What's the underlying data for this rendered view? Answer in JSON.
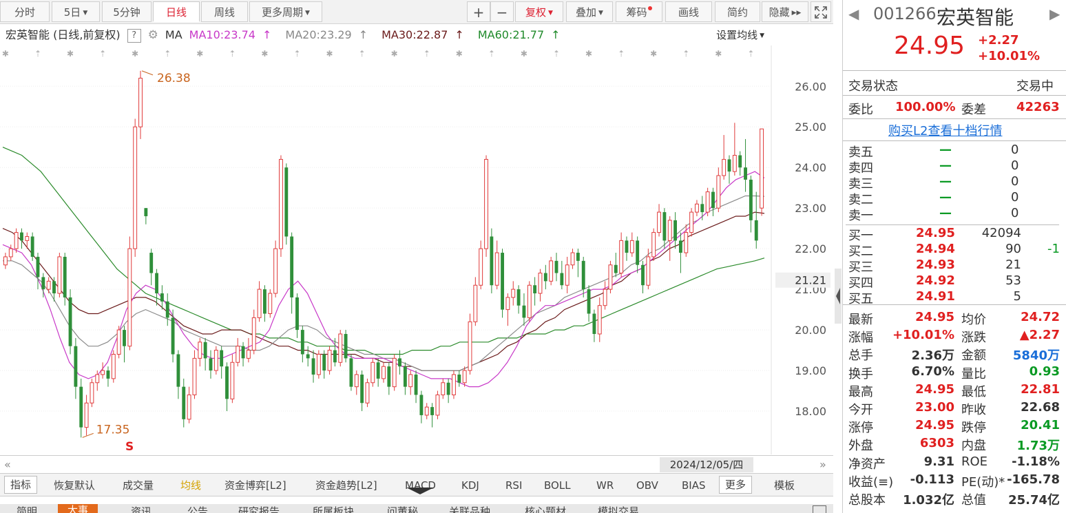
{
  "toolbar": {
    "tabs": [
      "分时",
      "5日",
      "5分钟",
      "日线",
      "周线",
      "更多周期"
    ],
    "buttons": [
      "+",
      "−",
      "复权",
      "叠加",
      "筹码",
      "画线",
      "简约",
      "隐藏"
    ],
    "active_tab": "日线"
  },
  "legend": {
    "title": "宏英智能 (日线,前复权)",
    "help": "?",
    "ma_label": "MA",
    "ma10": "MA10:23.74",
    "ma20": "MA20:23.29",
    "ma30": "MA30:22.87",
    "ma60": "MA60:21.77",
    "arrow": "↑",
    "set_ma": "设置均线"
  },
  "chart_data": {
    "type": "candlestick",
    "ylim": [
      17.0,
      26.7
    ],
    "yticks": [
      "26.00",
      "25.00",
      "24.00",
      "23.00",
      "22.00",
      "21.00",
      "20.00",
      "19.00",
      "18.00"
    ],
    "current_price_tag": "21.21",
    "high_annotation": "26.38",
    "low_annotation": "17.35",
    "s_marker": "S",
    "date_label": "2024/12/05/四",
    "colors": {
      "up": "#e03a3a",
      "down": "#2f8f3a",
      "ma10": "#c838c8",
      "ma20": "#8a8a8a",
      "ma30": "#6a1a1a",
      "ma60": "#2a8a2a"
    },
    "candles": [
      [
        21.6,
        21.8,
        21.9,
        21.5
      ],
      [
        21.8,
        22.0,
        22.1,
        21.7
      ],
      [
        22.0,
        22.4,
        22.5,
        21.9
      ],
      [
        22.4,
        22.2,
        22.5,
        22.0
      ],
      [
        22.2,
        22.3,
        22.4,
        22.0
      ],
      [
        22.3,
        21.8,
        22.4,
        21.7
      ],
      [
        21.8,
        21.3,
        21.9,
        21.0
      ],
      [
        21.3,
        21.0,
        21.4,
        20.8
      ],
      [
        21.0,
        21.2,
        21.3,
        20.9
      ],
      [
        21.2,
        20.9,
        21.3,
        20.7
      ],
      [
        20.9,
        21.8,
        21.9,
        20.8
      ],
      [
        21.8,
        20.8,
        21.9,
        20.6
      ],
      [
        20.8,
        19.6,
        21.0,
        19.4
      ],
      [
        19.6,
        18.6,
        19.8,
        18.3
      ],
      [
        18.6,
        17.6,
        18.8,
        17.35
      ],
      [
        17.6,
        18.2,
        18.4,
        17.4
      ],
      [
        18.2,
        18.7,
        18.8,
        18.1
      ],
      [
        18.7,
        18.9,
        19.0,
        18.5
      ],
      [
        18.9,
        19.0,
        19.2,
        18.8
      ],
      [
        19.0,
        18.8,
        19.1,
        18.6
      ],
      [
        18.8,
        19.4,
        19.5,
        18.7
      ],
      [
        19.4,
        20.0,
        20.1,
        19.3
      ],
      [
        20.0,
        19.6,
        20.1,
        19.2
      ],
      [
        19.6,
        22.0,
        22.3,
        19.5
      ],
      [
        22.0,
        25.0,
        25.2,
        21.8
      ],
      [
        25.0,
        26.2,
        26.38,
        24.7
      ],
      [
        23.0,
        22.8,
        23.0,
        22.6
      ],
      [
        21.9,
        21.4,
        22.0,
        21.1
      ],
      [
        21.4,
        20.9,
        21.5,
        20.6
      ],
      [
        20.9,
        20.7,
        21.1,
        20.5
      ],
      [
        20.7,
        20.3,
        20.9,
        20.1
      ],
      [
        20.3,
        19.4,
        20.5,
        19.2
      ],
      [
        19.4,
        18.6,
        19.5,
        18.3
      ],
      [
        18.6,
        17.8,
        18.8,
        17.6
      ],
      [
        17.8,
        18.4,
        18.6,
        17.7
      ],
      [
        18.4,
        19.3,
        19.5,
        18.3
      ],
      [
        19.3,
        19.7,
        19.8,
        19.1
      ],
      [
        19.7,
        19.3,
        19.8,
        19.0
      ],
      [
        19.3,
        19.0,
        19.5,
        18.8
      ],
      [
        19.0,
        19.5,
        19.6,
        18.9
      ],
      [
        19.5,
        19.1,
        19.6,
        18.8
      ],
      [
        19.1,
        18.3,
        19.2,
        18.0
      ],
      [
        18.3,
        19.2,
        19.4,
        18.2
      ],
      [
        19.2,
        19.6,
        19.8,
        19.1
      ],
      [
        19.6,
        19.3,
        19.7,
        19.1
      ],
      [
        19.3,
        19.5,
        19.8,
        19.2
      ],
      [
        19.5,
        20.3,
        20.5,
        19.4
      ],
      [
        20.3,
        21.0,
        21.2,
        20.2
      ],
      [
        21.0,
        20.4,
        21.1,
        20.2
      ],
      [
        20.4,
        20.9,
        21.0,
        20.3
      ],
      [
        20.9,
        22.0,
        22.2,
        20.8
      ],
      [
        22.0,
        24.2,
        24.3,
        21.8
      ],
      [
        24.0,
        22.3,
        24.1,
        22.1
      ],
      [
        22.3,
        20.8,
        22.4,
        20.4
      ],
      [
        20.8,
        20.0,
        20.9,
        19.8
      ],
      [
        20.0,
        19.4,
        20.1,
        19.2
      ],
      [
        19.4,
        19.3,
        19.6,
        19.1
      ],
      [
        19.3,
        18.9,
        19.5,
        18.7
      ],
      [
        18.9,
        19.4,
        19.5,
        18.8
      ],
      [
        19.4,
        19.0,
        19.5,
        18.8
      ],
      [
        19.0,
        19.5,
        19.6,
        18.9
      ],
      [
        19.5,
        19.2,
        19.8,
        19.1
      ],
      [
        19.2,
        19.9,
        20.0,
        19.1
      ],
      [
        19.9,
        19.3,
        20.0,
        19.2
      ],
      [
        19.3,
        18.6,
        19.4,
        18.5
      ],
      [
        18.6,
        18.9,
        19.0,
        18.4
      ],
      [
        18.9,
        18.2,
        19.0,
        18.0
      ],
      [
        18.2,
        18.7,
        18.8,
        18.1
      ],
      [
        18.7,
        19.2,
        19.3,
        18.6
      ],
      [
        19.2,
        18.8,
        19.3,
        18.6
      ],
      [
        18.8,
        19.1,
        19.2,
        18.7
      ],
      [
        19.1,
        18.6,
        19.2,
        18.4
      ],
      [
        18.6,
        19.3,
        19.4,
        18.5
      ],
      [
        19.3,
        19.1,
        19.5,
        18.9
      ],
      [
        19.1,
        18.6,
        19.2,
        18.4
      ],
      [
        18.6,
        18.9,
        19.0,
        18.4
      ],
      [
        18.9,
        18.4,
        19.0,
        18.2
      ],
      [
        18.4,
        17.9,
        18.5,
        17.7
      ],
      [
        17.9,
        18.1,
        18.2,
        17.8
      ],
      [
        18.1,
        17.9,
        18.2,
        17.6
      ],
      [
        17.9,
        18.4,
        18.5,
        17.8
      ],
      [
        18.4,
        18.7,
        18.8,
        18.3
      ],
      [
        18.7,
        18.4,
        18.8,
        18.2
      ],
      [
        18.4,
        18.9,
        19.0,
        18.3
      ],
      [
        18.9,
        18.7,
        19.0,
        18.6
      ],
      [
        18.7,
        19.0,
        19.1,
        18.6
      ],
      [
        19.0,
        20.2,
        20.4,
        18.9
      ],
      [
        20.2,
        21.1,
        21.3,
        20.1
      ],
      [
        21.1,
        22.0,
        22.2,
        21.0
      ],
      [
        22.0,
        24.2,
        24.3,
        21.8
      ],
      [
        22.3,
        21.1,
        22.5,
        20.9
      ],
      [
        21.1,
        21.9,
        22.2,
        21.0
      ],
      [
        21.9,
        20.5,
        22.0,
        20.3
      ],
      [
        20.5,
        20.8,
        20.9,
        20.1
      ],
      [
        20.8,
        21.0,
        21.2,
        20.6
      ],
      [
        21.0,
        20.6,
        21.1,
        20.4
      ],
      [
        20.6,
        20.3,
        20.9,
        20.1
      ],
      [
        20.3,
        21.1,
        21.2,
        20.2
      ],
      [
        21.1,
        20.9,
        21.3,
        20.6
      ],
      [
        20.9,
        21.4,
        21.5,
        20.7
      ],
      [
        21.4,
        21.2,
        21.6,
        21.0
      ],
      [
        21.2,
        21.7,
        21.8,
        21.1
      ],
      [
        21.7,
        21.4,
        21.9,
        21.2
      ],
      [
        21.4,
        21.1,
        21.7,
        21.0
      ],
      [
        21.1,
        21.6,
        21.8,
        20.9
      ],
      [
        21.6,
        21.9,
        22.0,
        21.5
      ],
      [
        21.9,
        21.7,
        22.0,
        21.3
      ],
      [
        21.7,
        21.0,
        21.8,
        20.8
      ],
      [
        21.0,
        20.4,
        21.1,
        20.2
      ],
      [
        20.4,
        19.9,
        20.5,
        19.7
      ],
      [
        19.9,
        20.6,
        20.8,
        19.7
      ],
      [
        20.6,
        21.0,
        21.2,
        20.5
      ],
      [
        21.0,
        21.6,
        21.7,
        20.9
      ],
      [
        21.6,
        21.4,
        21.9,
        21.3
      ],
      [
        21.4,
        22.2,
        22.4,
        21.3
      ],
      [
        22.2,
        21.9,
        22.3,
        21.7
      ],
      [
        21.9,
        22.2,
        22.4,
        21.8
      ],
      [
        22.2,
        21.6,
        22.3,
        21.4
      ],
      [
        21.6,
        21.1,
        21.7,
        20.9
      ],
      [
        21.1,
        21.8,
        22.0,
        21.0
      ],
      [
        21.8,
        22.4,
        22.5,
        21.7
      ],
      [
        22.4,
        22.9,
        23.1,
        22.3
      ],
      [
        22.9,
        22.2,
        23.0,
        22.0
      ],
      [
        22.2,
        22.7,
        22.8,
        21.7
      ],
      [
        22.7,
        22.2,
        22.9,
        22.0
      ],
      [
        22.2,
        21.9,
        22.4,
        21.4
      ],
      [
        21.9,
        22.4,
        22.6,
        21.8
      ],
      [
        22.4,
        22.9,
        23.0,
        22.3
      ],
      [
        22.9,
        23.1,
        23.2,
        22.8
      ],
      [
        23.1,
        22.9,
        23.3,
        22.7
      ],
      [
        22.9,
        23.4,
        23.5,
        22.8
      ],
      [
        23.4,
        23.0,
        23.5,
        22.8
      ],
      [
        23.0,
        23.8,
        24.0,
        22.9
      ],
      [
        23.8,
        24.2,
        24.8,
        23.7
      ],
      [
        24.2,
        23.9,
        24.3,
        23.6
      ],
      [
        23.9,
        24.3,
        25.1,
        23.8
      ],
      [
        24.3,
        24.0,
        24.4,
        23.8
      ],
      [
        24.0,
        23.7,
        24.7,
        23.4
      ],
      [
        23.7,
        22.7,
        23.8,
        22.4
      ],
      [
        22.7,
        22.2,
        23.4,
        22.0
      ],
      [
        23.0,
        24.95,
        24.95,
        22.81
      ]
    ],
    "ma10": [
      22.1,
      22.0,
      21.9,
      21.6,
      21.1,
      20.5,
      19.8,
      19.2,
      18.9,
      18.8,
      18.9,
      19.2,
      19.8,
      20.5,
      20.9,
      21.1,
      21.0,
      20.7,
      20.3,
      19.9,
      19.6,
      19.4,
      19.3,
      19.3,
      19.4,
      19.5,
      19.6,
      19.7,
      20.0,
      20.6,
      21.0,
      21.2,
      20.9,
      20.4,
      19.9,
      19.6,
      19.4,
      19.3,
      19.3,
      19.3,
      19.3,
      19.2,
      19.1,
      19.0,
      18.9,
      18.8,
      18.8,
      18.8,
      18.7,
      18.6,
      18.6,
      18.7,
      18.9,
      19.2,
      19.6,
      20.1,
      20.4,
      20.6,
      20.6,
      20.7,
      20.8,
      20.9,
      21.0,
      21.0,
      21.1,
      21.3,
      21.4,
      21.5,
      21.7,
      21.9,
      22.1,
      22.3,
      22.5,
      22.7,
      22.9,
      23.2,
      23.5,
      23.7,
      23.8,
      23.9,
      23.74
    ],
    "ma20": [
      21.7,
      21.7,
      21.6,
      21.4,
      21.2,
      20.9,
      20.5,
      20.1,
      19.8,
      19.6,
      19.6,
      19.7,
      19.9,
      20.2,
      20.4,
      20.5,
      20.4,
      20.3,
      20.2,
      20.0,
      19.9,
      19.8,
      19.7,
      19.6,
      19.6,
      19.6,
      19.5,
      19.5,
      19.6,
      19.8,
      20.0,
      20.1,
      20.1,
      20.0,
      19.8,
      19.7,
      19.6,
      19.5,
      19.4,
      19.4,
      19.3,
      19.3,
      19.2,
      19.1,
      19.0,
      19.0,
      19.0,
      19.0,
      19.0,
      19.1,
      19.2,
      19.4,
      19.6,
      19.8,
      20.0,
      20.2,
      20.4,
      20.5,
      20.6,
      20.8,
      20.9,
      21.0,
      21.1,
      21.2,
      21.3,
      21.4,
      21.6,
      21.7,
      21.9,
      22.0,
      22.2,
      22.4,
      22.6,
      22.7,
      22.9,
      23.0,
      23.1,
      23.2,
      23.3,
      23.3,
      23.29
    ],
    "ma30": [
      22.5,
      22.4,
      22.2,
      21.9,
      21.6,
      21.3,
      21.0,
      20.7,
      20.5,
      20.4,
      20.4,
      20.5,
      20.6,
      20.7,
      20.8,
      20.8,
      20.7,
      20.5,
      20.3,
      20.1,
      20.0,
      19.9,
      19.9,
      20.0,
      20.0,
      20.0,
      19.9,
      19.8,
      19.7,
      19.6,
      19.6,
      19.5,
      19.5,
      19.4,
      19.4,
      19.4,
      19.4,
      19.4,
      19.3,
      19.3,
      19.2,
      19.2,
      19.1,
      19.1,
      19.0,
      19.0,
      19.0,
      19.0,
      19.0,
      19.1,
      19.2,
      19.3,
      19.4,
      19.6,
      19.7,
      19.9,
      20.0,
      20.2,
      20.3,
      20.5,
      20.6,
      20.7,
      20.8,
      20.9,
      21.1,
      21.2,
      21.4,
      21.5,
      21.7,
      21.8,
      22.0,
      22.1,
      22.3,
      22.4,
      22.5,
      22.6,
      22.7,
      22.8,
      22.8,
      22.9,
      22.87
    ],
    "ma60": [
      24.5,
      24.4,
      24.3,
      24.1,
      23.9,
      23.6,
      23.3,
      23.0,
      22.7,
      22.4,
      22.1,
      21.8,
      21.5,
      21.3,
      21.1,
      20.9,
      20.8,
      20.7,
      20.6,
      20.5,
      20.4,
      20.3,
      20.2,
      20.1,
      20.0,
      20.0,
      19.9,
      19.9,
      19.8,
      19.8,
      19.8,
      19.7,
      19.7,
      19.6,
      19.6,
      19.6,
      19.5,
      19.5,
      19.5,
      19.4,
      19.4,
      19.4,
      19.4,
      19.5,
      19.5,
      19.5,
      19.6,
      19.6,
      19.7,
      19.7,
      19.7,
      19.7,
      19.8,
      19.8,
      19.8,
      19.9,
      19.9,
      19.9,
      20.0,
      20.0,
      20.1,
      20.1,
      20.2,
      20.3,
      20.4,
      20.5,
      20.6,
      20.7,
      20.8,
      20.9,
      21.0,
      21.1,
      21.2,
      21.3,
      21.4,
      21.5,
      21.55,
      21.6,
      21.65,
      21.7,
      21.77
    ]
  },
  "scroll": {
    "date": "2024/12/05/四"
  },
  "indicator_tabs": [
    "指标",
    "恢复默认",
    "成交量",
    "均线",
    "资金博弈[L2]",
    "资金趋势[L2]",
    "MACD",
    "KDJ",
    "RSI",
    "BOLL",
    "WR",
    "OBV",
    "BIAS",
    "更多",
    "模板"
  ],
  "bottom_tabs": [
    "简明",
    "大事",
    "资讯",
    "公告",
    "研究报告",
    "所属板块",
    "问董秘",
    "关联品种",
    "核心题材",
    "模拟交易"
  ],
  "panel": {
    "code": "001266",
    "name": "宏英智能",
    "price": "24.95",
    "change": "+2.27",
    "change_pct": "+10.01%",
    "trade_status_label": "交易状态",
    "trade_status": "交易中",
    "wb_label": "委比",
    "wb": "100.00%",
    "wc_label": "委差",
    "wc": "42263",
    "l2_link": "购买L2查看十档行情",
    "asks": [
      {
        "label": "卖五",
        "price": "—",
        "vol": "0"
      },
      {
        "label": "卖四",
        "price": "—",
        "vol": "0"
      },
      {
        "label": "卖三",
        "price": "—",
        "vol": "0"
      },
      {
        "label": "卖二",
        "price": "—",
        "vol": "0"
      },
      {
        "label": "卖一",
        "price": "—",
        "vol": "0"
      }
    ],
    "bids": [
      {
        "label": "买一",
        "price": "24.95",
        "vol": "42094",
        "delta": ""
      },
      {
        "label": "买二",
        "price": "24.94",
        "vol": "90",
        "delta": "-1"
      },
      {
        "label": "买三",
        "price": "24.93",
        "vol": "21",
        "delta": ""
      },
      {
        "label": "买四",
        "price": "24.92",
        "vol": "53",
        "delta": ""
      },
      {
        "label": "买五",
        "price": "24.91",
        "vol": "5",
        "delta": ""
      }
    ],
    "stats": [
      {
        "l1": "最新",
        "v1": "24.95",
        "c1": "r",
        "l2": "均价",
        "v2": "24.72",
        "c2": "r"
      },
      {
        "l1": "涨幅",
        "v1": "+10.01%",
        "c1": "r",
        "l2": "涨跌",
        "v2": "▲2.27",
        "c2": "r"
      },
      {
        "l1": "总手",
        "v1": "2.36万",
        "c1": "",
        "l2": "金额",
        "v2": "5840万",
        "c2": "b"
      },
      {
        "l1": "换手",
        "v1": "6.70%",
        "c1": "",
        "l2": "量比",
        "v2": "0.93",
        "c2": "g"
      },
      {
        "l1": "最高",
        "v1": "24.95",
        "c1": "r",
        "l2": "最低",
        "v2": "22.81",
        "c2": "r"
      },
      {
        "l1": "今开",
        "v1": "23.00",
        "c1": "r",
        "l2": "昨收",
        "v2": "22.68",
        "c2": ""
      },
      {
        "l1": "涨停",
        "v1": "24.95",
        "c1": "r",
        "l2": "跌停",
        "v2": "20.41",
        "c2": "g"
      },
      {
        "l1": "外盘",
        "v1": "6303",
        "c1": "r",
        "l2": "内盘",
        "v2": "1.73万",
        "c2": "g"
      },
      {
        "l1": "净资产",
        "v1": "9.31",
        "c1": "",
        "l2": "ROE",
        "v2": "-1.18%",
        "c2": ""
      },
      {
        "l1": "收益(≡)",
        "v1": "-0.113",
        "c1": "",
        "l2": "PE(动)*",
        "v2": "-165.78",
        "c2": ""
      },
      {
        "l1": "总股本",
        "v1": "1.032亿",
        "c1": "",
        "l2": "总值",
        "v2": "25.74亿",
        "c2": ""
      }
    ]
  }
}
